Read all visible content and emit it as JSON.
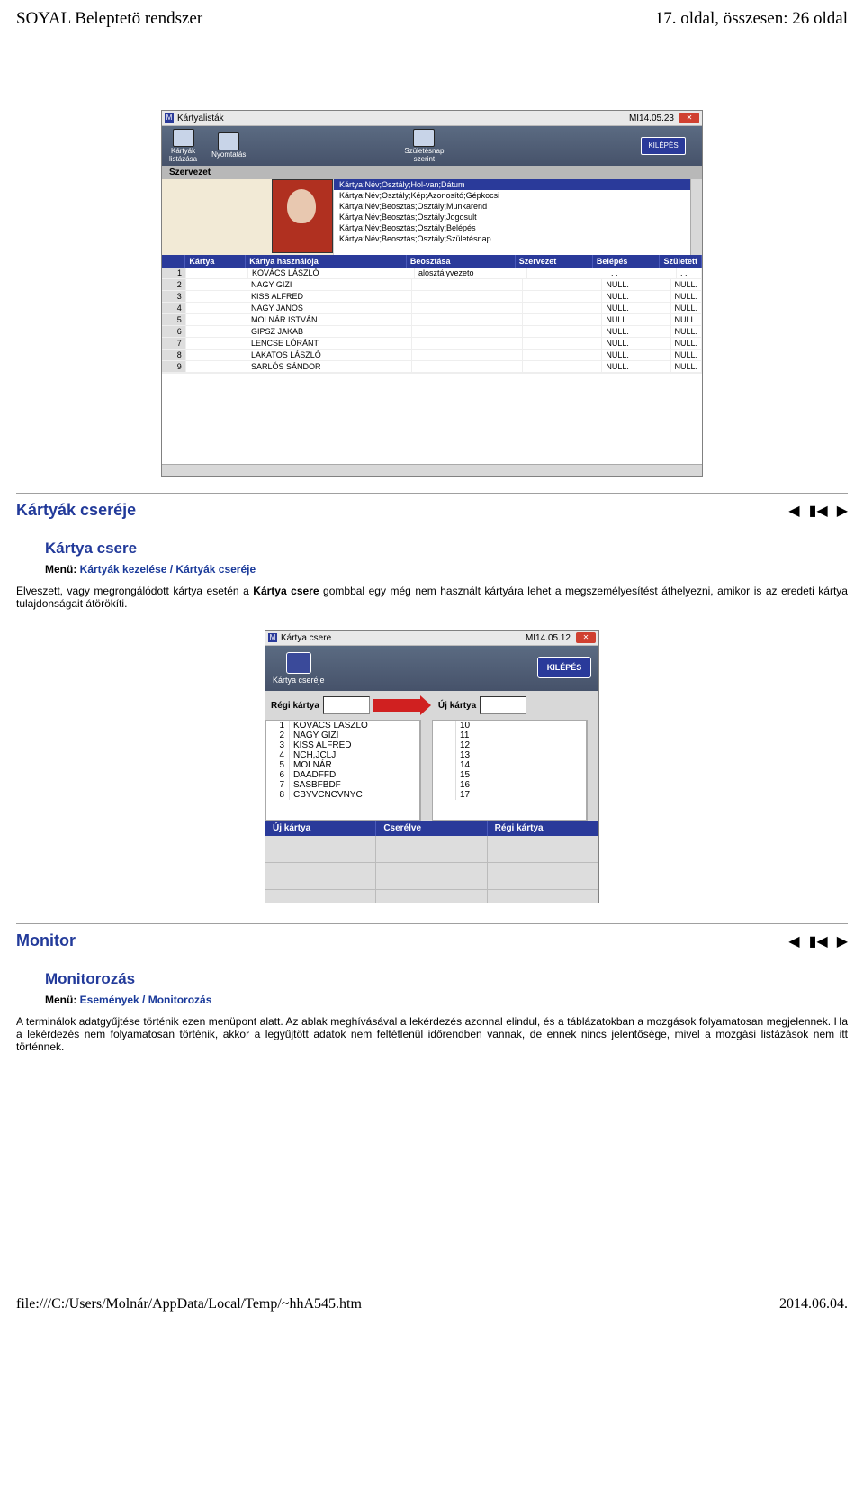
{
  "header": {
    "left": "SOYAL Beleptetö rendszer",
    "right": "17. oldal, összesen: 26 oldal"
  },
  "footer": {
    "left": "file:///C:/Users/Molnár/AppData/Local/Temp/~hhA545.htm",
    "right": "2014.06.04."
  },
  "win1": {
    "title": "Kártyalisták",
    "version": "MI14.05.23",
    "toolbar": {
      "btn1": "Kártyák\nlistázása",
      "btn2": "Nyomtatás",
      "btn3": "Születésnap\nszerint",
      "kilepes": "KILÉPÉS"
    },
    "subbar": "Szervezet",
    "dropdown": [
      "Kártya;Név;Osztály;Hol-van;Dátum",
      "Kártya;Név;Osztály;Kép;Azonosító;Gépkocsi",
      "Kártya;Név;Beosztás;Osztály;Munkarend",
      "Kártya;Név;Beosztás;Osztály;Jogosult",
      "Kártya;Név;Beosztás;Osztály;Belépés",
      "Kártya;Név;Beosztás;Osztály;Születésnap"
    ],
    "cols": {
      "num": "",
      "kartya": "Kártya",
      "name": "Kártya használója",
      "beo": "Beosztása",
      "szerv": "Szervezet",
      "bel": "Belépés",
      "szul": "Született"
    },
    "rows": [
      {
        "n": "1",
        "name": "KOVÁCS LÁSZLÓ",
        "beo": "alosztályvezeto",
        "bel": ". .",
        "szul": ". ."
      },
      {
        "n": "2",
        "name": "NAGY GIZI",
        "beo": "",
        "bel": "NULL.",
        "szul": "NULL."
      },
      {
        "n": "3",
        "name": "KISS ALFRED",
        "beo": "",
        "bel": "NULL.",
        "szul": "NULL."
      },
      {
        "n": "4",
        "name": "NAGY JÁNOS",
        "beo": "",
        "bel": "NULL.",
        "szul": "NULL."
      },
      {
        "n": "5",
        "name": "MOLNÁR ISTVÁN",
        "beo": "",
        "bel": "NULL.",
        "szul": "NULL."
      },
      {
        "n": "6",
        "name": "GIPSZ JAKAB",
        "beo": "",
        "bel": "NULL.",
        "szul": "NULL."
      },
      {
        "n": "7",
        "name": "LENCSE LÓRÁNT",
        "beo": "",
        "bel": "NULL.",
        "szul": "NULL."
      },
      {
        "n": "8",
        "name": "LAKATOS LÁSZLÓ",
        "beo": "",
        "bel": "NULL.",
        "szul": "NULL."
      },
      {
        "n": "9",
        "name": "SARLÓS SÁNDOR",
        "beo": "",
        "bel": "NULL.",
        "szul": "NULL."
      }
    ]
  },
  "section1": {
    "heading": "Kártyák cseréje",
    "subheading": "Kártya csere",
    "menulabel": "Menü:",
    "menupath": "Kártyák kezelése  / Kártyák cseréje",
    "body_pre": "Elveszett, vagy megrongálódott kártya esetén a ",
    "body_bold": "Kártya csere",
    "body_post": " gombbal egy még nem használt kártyára lehet a megszemélyesítést áthelyezni, amikor is az eredeti kártya tulajdonságait átörökíti."
  },
  "win2": {
    "title": "Kártya csere",
    "version": "MI14.05.12",
    "toolbar": {
      "btn1": "Kártya cseréje",
      "kilepes": "KILÉPÉS"
    },
    "labels": {
      "regi": "Régi kártya",
      "uj": "Új kártya"
    },
    "left": [
      {
        "n": "1",
        "v": "KOVÁCS LÁSZLÓ"
      },
      {
        "n": "2",
        "v": "NAGY GIZI"
      },
      {
        "n": "3",
        "v": "KISS ALFRED"
      },
      {
        "n": "4",
        "v": "NCH,JCLJ"
      },
      {
        "n": "5",
        "v": "MOLNÁR"
      },
      {
        "n": "6",
        "v": "DAADFFD"
      },
      {
        "n": "7",
        "v": "SASBFBDF"
      },
      {
        "n": "8",
        "v": "CBYVCNCVNYC"
      }
    ],
    "right": [
      "10",
      "11",
      "12",
      "13",
      "14",
      "15",
      "16",
      "17"
    ],
    "rescols": {
      "a": "Új kártya",
      "b": "Cserélve",
      "c": "Régi kártya"
    }
  },
  "section2": {
    "heading": "Monitor",
    "subheading": "Monitorozás",
    "menulabel": "Menü:",
    "menupath": "Események / Monitorozás",
    "body": "A terminálok adatgyűjtése történik ezen menüpont alatt. Az ablak meghívásával a lekérdezés azonnal elindul, és a táblázatokban a mozgások folyamatosan megjelennek. Ha a lekérdezés nem folyamatosan történik, akkor a legyűjtött adatok nem feltétlenül időrendben vannak, de ennek nincs jelentősége, mivel a mozgási listázások nem itt történnek."
  },
  "nav": {
    "prev": "◀",
    "first": "▮◀",
    "next": "▶"
  }
}
